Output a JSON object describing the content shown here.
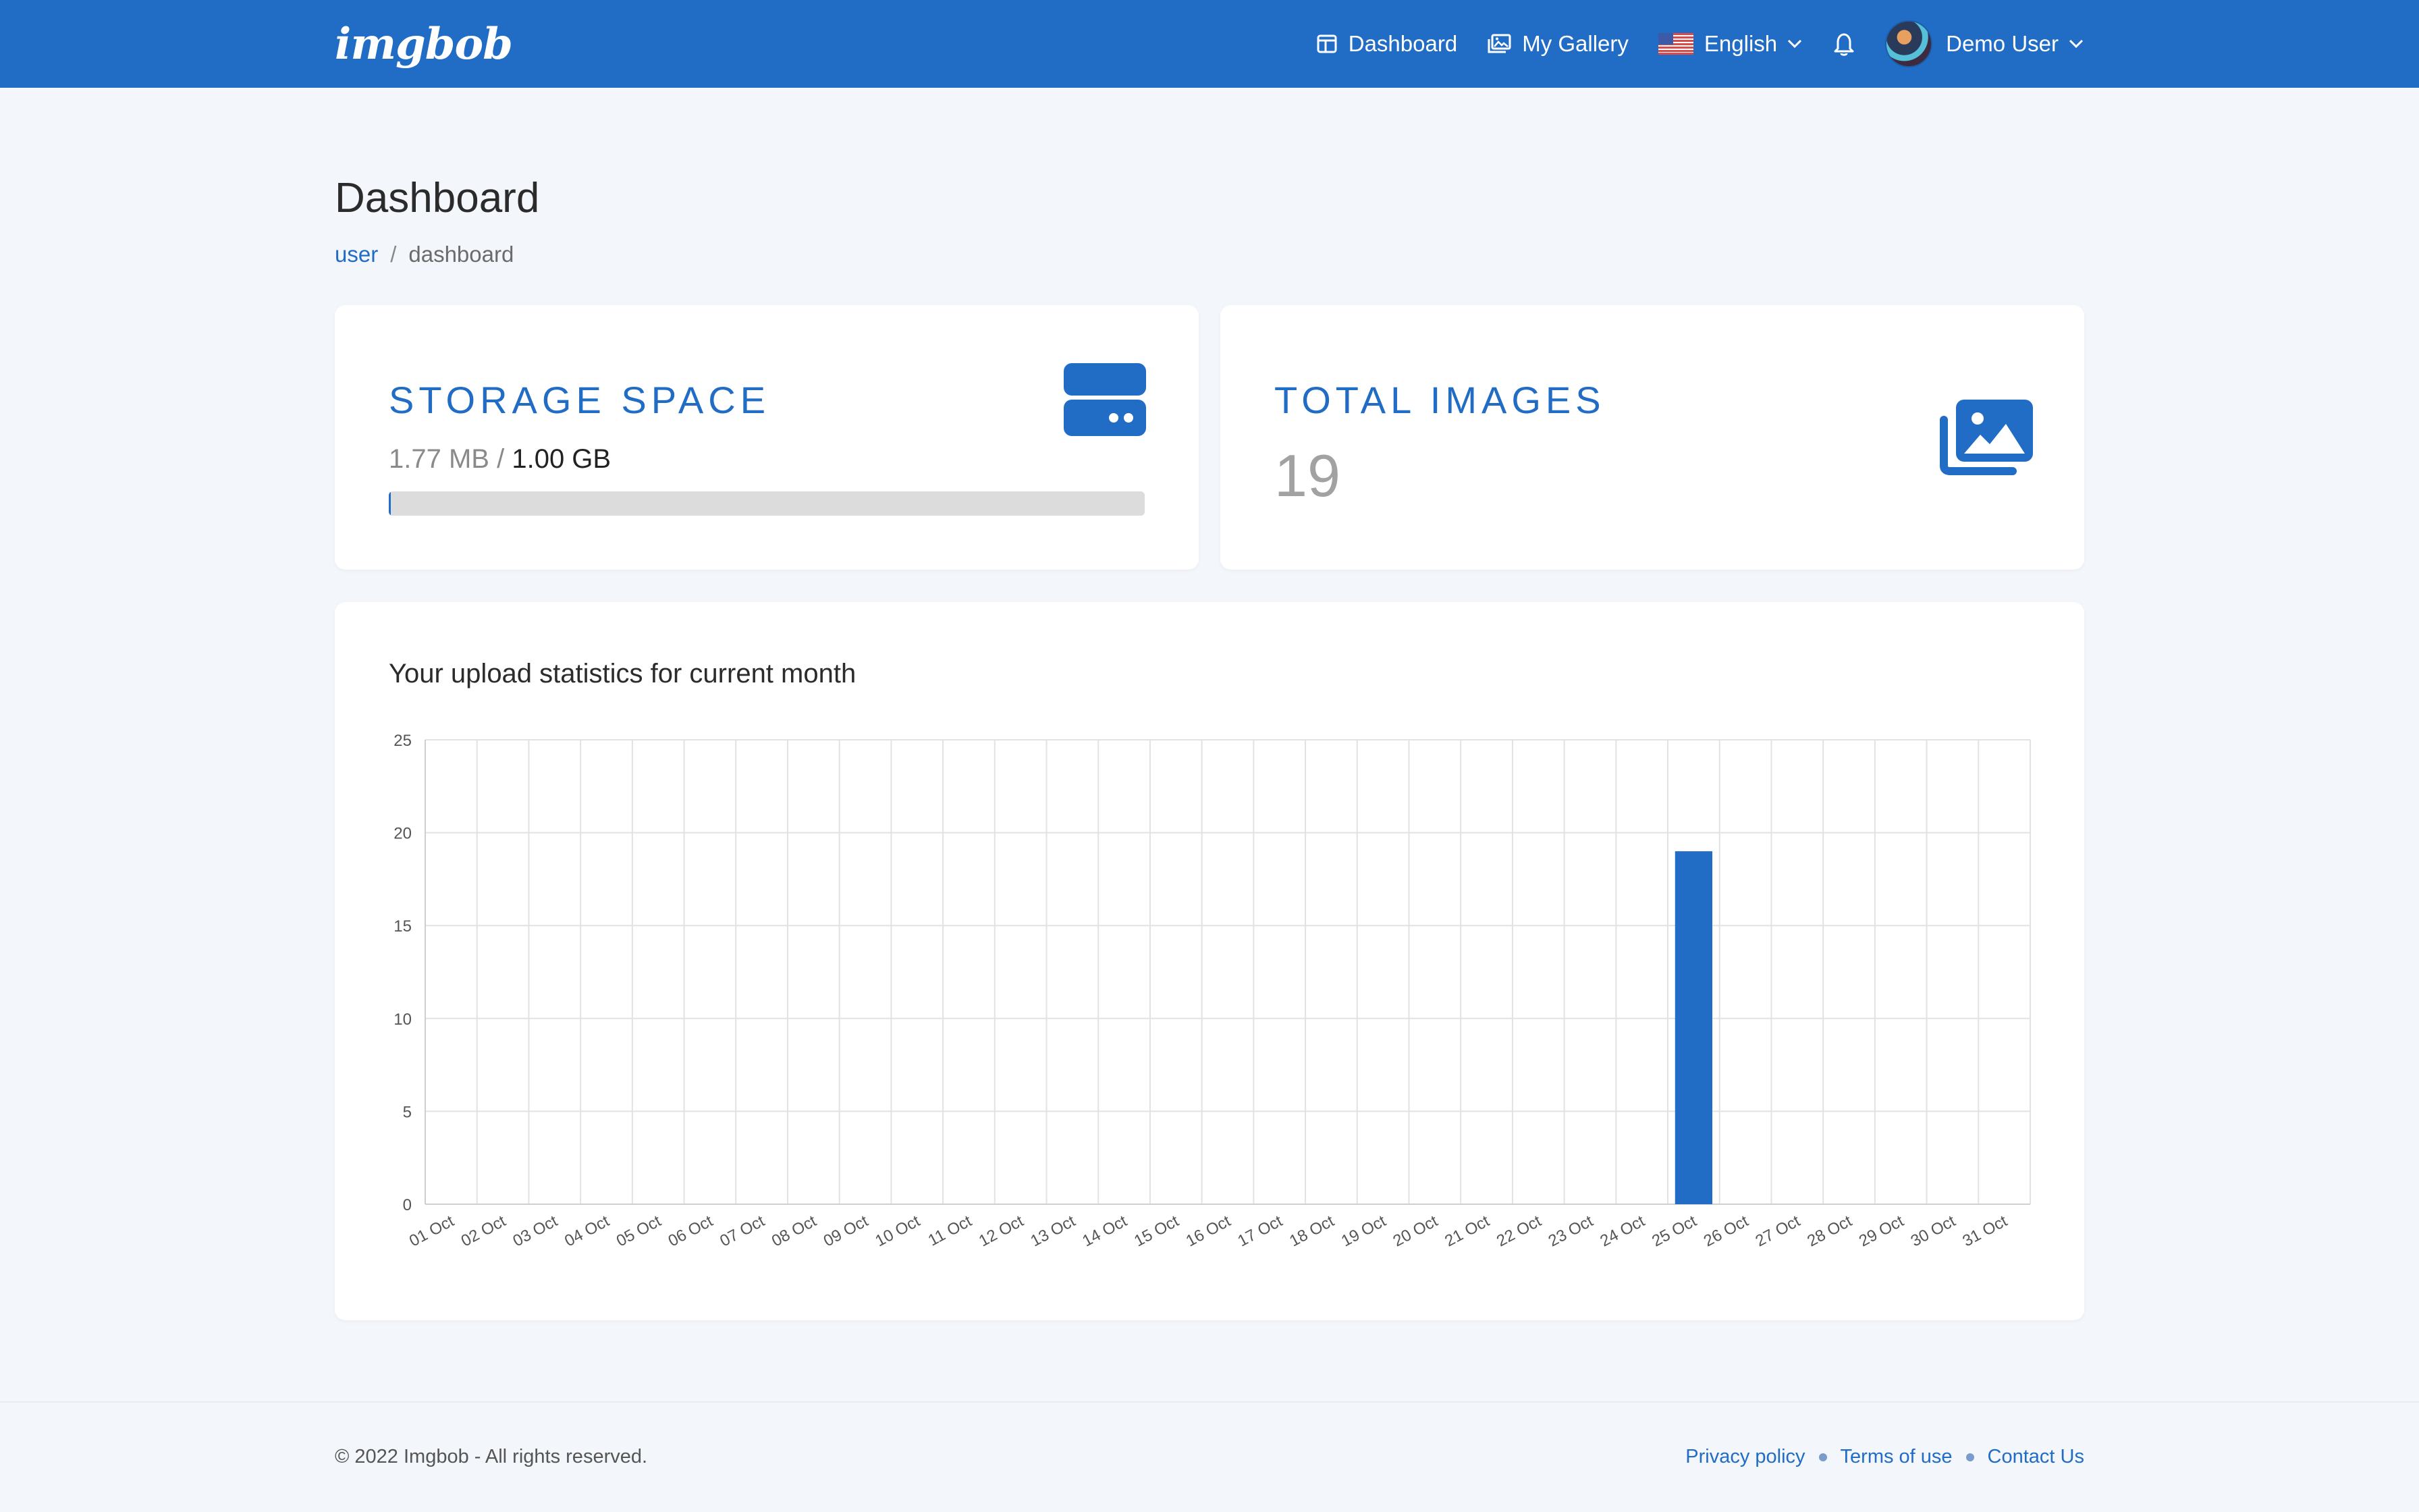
{
  "navbar": {
    "brand": "imgbob",
    "links": {
      "dashboard": "Dashboard",
      "gallery": "My Gallery",
      "language": "English",
      "user": "Demo User"
    },
    "icons": [
      "dashboard-icon",
      "gallery-icon",
      "us-flag-icon",
      "chevron-down-icon",
      "bell-icon",
      "avatar"
    ],
    "color": "#216cc4"
  },
  "page": {
    "title": "Dashboard",
    "breadcrumb": {
      "link": "user",
      "separator": "/",
      "current": "dashboard"
    }
  },
  "storage": {
    "title": "STORAGE SPACE",
    "used": "1.77 MB",
    "slash": "/",
    "total": "1.00 GB",
    "used_fraction": 0.0018,
    "icon": "hard-drive-icon"
  },
  "images": {
    "title": "TOTAL IMAGES",
    "count": "19",
    "icon": "images-icon"
  },
  "chart_card": {
    "heading": "Your upload statistics for current month"
  },
  "chart_data": {
    "type": "bar",
    "categories": [
      "01 Oct",
      "02 Oct",
      "03 Oct",
      "04 Oct",
      "05 Oct",
      "06 Oct",
      "07 Oct",
      "08 Oct",
      "09 Oct",
      "10 Oct",
      "11 Oct",
      "12 Oct",
      "13 Oct",
      "14 Oct",
      "15 Oct",
      "16 Oct",
      "17 Oct",
      "18 Oct",
      "19 Oct",
      "20 Oct",
      "21 Oct",
      "22 Oct",
      "23 Oct",
      "24 Oct",
      "25 Oct",
      "26 Oct",
      "27 Oct",
      "28 Oct",
      "29 Oct",
      "30 Oct",
      "31 Oct"
    ],
    "values": [
      0,
      0,
      0,
      0,
      0,
      0,
      0,
      0,
      0,
      0,
      0,
      0,
      0,
      0,
      0,
      0,
      0,
      0,
      0,
      0,
      0,
      0,
      0,
      0,
      19,
      0,
      0,
      0,
      0,
      0,
      0
    ],
    "yticks": [
      "0",
      "5",
      "10",
      "15",
      "20",
      "25"
    ],
    "ylim": [
      0,
      25
    ],
    "grid": true,
    "color": "#216cc4"
  },
  "footer": {
    "copyright": "© 2022 Imgbob - All rights reserved.",
    "links": {
      "privacy": "Privacy policy",
      "terms": "Terms of use",
      "contact": "Contact Us"
    }
  }
}
